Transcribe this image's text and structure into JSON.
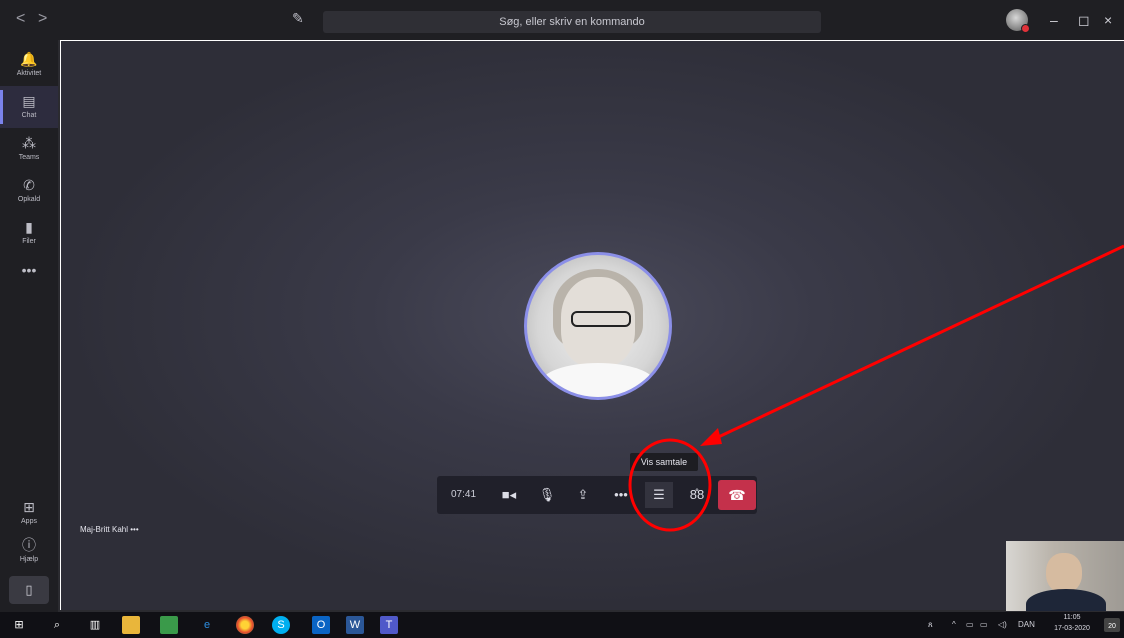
{
  "titlebar": {
    "back": "<",
    "forward": ">",
    "search_placeholder": "Søg, eller skriv en kommando",
    "min": "–",
    "max": "◻",
    "close": "×"
  },
  "sidebar": {
    "items": [
      {
        "label": "Aktivitet",
        "icon": "bell-icon"
      },
      {
        "label": "Chat",
        "icon": "chat-icon"
      },
      {
        "label": "Teams",
        "icon": "teams-icon"
      },
      {
        "label": "Opkald",
        "icon": "phone-icon"
      },
      {
        "label": "Filer",
        "icon": "file-icon"
      }
    ],
    "more": "•••",
    "apps_label": "Apps",
    "help_label": "Hjælp"
  },
  "call": {
    "tooltip": "Vis samtale",
    "timer": "07:41",
    "participant": "Maj-Britt Kahl"
  },
  "taskbar": {
    "language": "DAN",
    "time": "11:05",
    "date": "17-03-2020",
    "notification_badge": "20"
  },
  "colors": {
    "accent": "#7b83eb",
    "hangup": "#c4314b",
    "annotation": "#ff0000"
  }
}
